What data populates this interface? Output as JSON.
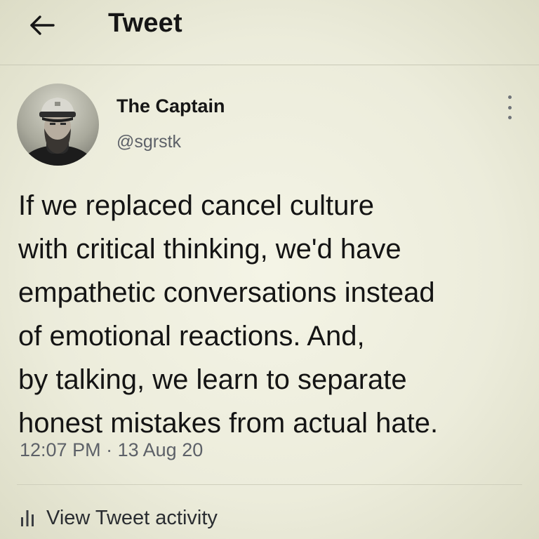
{
  "header": {
    "title": "Tweet",
    "back_icon": "arrow-left-icon"
  },
  "author": {
    "display_name": "The Captain",
    "handle": "@sgrstk",
    "avatar_icon": "profile-photo",
    "more_icon": "more-vertical-icon"
  },
  "tweet": {
    "lines": [
      "If we replaced cancel culture",
      "with critical thinking, we'd have",
      "empathetic conversations instead",
      "of emotional reactions. And,",
      "by talking, we learn to separate",
      "honest mistakes from actual hate."
    ],
    "time": "12:07 PM",
    "separator": "·",
    "date": "13 Aug 20"
  },
  "footer": {
    "activity_icon": "bar-chart-icon",
    "activity_label": "View Tweet activity"
  },
  "colors": {
    "background": "#ecece0",
    "text": "#141414",
    "muted": "#5d6168"
  }
}
